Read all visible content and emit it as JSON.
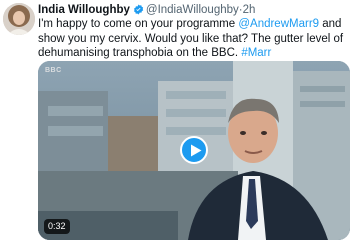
{
  "tweet": {
    "author_name": "India Willoughby",
    "author_handle": "@IndiaWilloughby",
    "separator": "·",
    "timestamp": "2h",
    "text_part1": "I'm happy to come on your programme ",
    "mention": "@AndrewMarr9",
    "text_part2": " and show you my cervix. Would you like that? The gutter level of dehumanising transphobia on the BBC. ",
    "hashtag": "#Marr"
  },
  "video": {
    "duration": "0:32",
    "overlay_logo": "BBC"
  },
  "icons": {
    "verified": "verified-badge-icon",
    "play": "play-icon",
    "avatar": "avatar"
  },
  "colors": {
    "link": "#1d9bf0",
    "secondary_text": "#536471",
    "text": "#0f1419"
  }
}
